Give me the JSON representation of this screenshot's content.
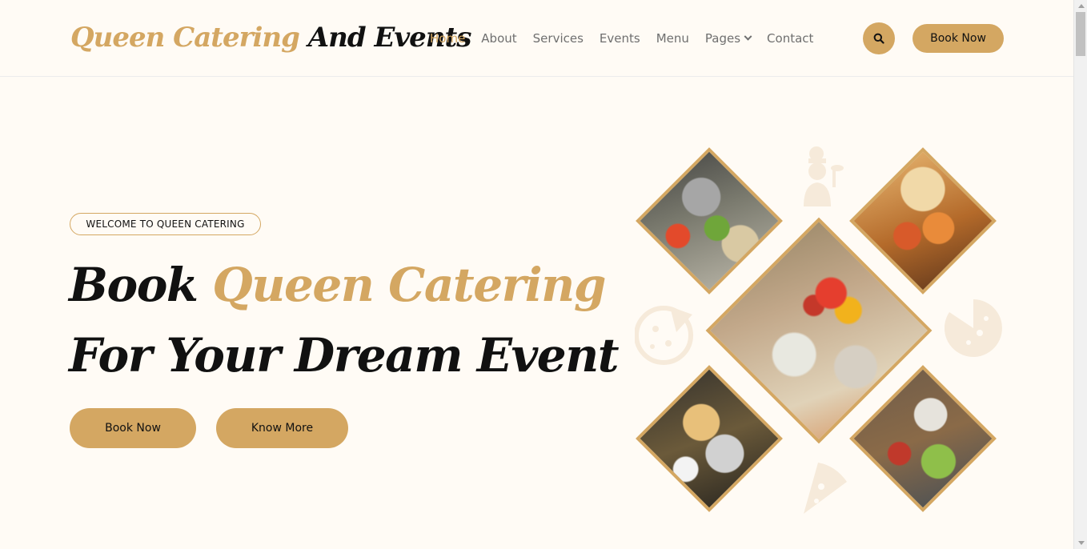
{
  "brand": {
    "accent_text": "Queen Catering",
    "dark_text": "And Events"
  },
  "nav": {
    "items": [
      {
        "label": "Home",
        "active": true
      },
      {
        "label": "About"
      },
      {
        "label": "Services"
      },
      {
        "label": "Events"
      },
      {
        "label": "Menu"
      },
      {
        "label": "Pages",
        "has_dropdown": true
      },
      {
        "label": "Contact"
      }
    ],
    "search_icon": "search-icon",
    "book_label": "Book Now"
  },
  "hero": {
    "badge": "WELCOME TO QUEEN CATERING",
    "line1_dark": "Book",
    "line1_accent": "Queen Catering",
    "line2": "For Your Dream Event",
    "book_label": "Book Now",
    "more_label": "Know More"
  },
  "colors": {
    "accent": "#d4a762",
    "dark": "#111111",
    "background": "#fffbf5",
    "muted_nav": "#6f6f6f"
  }
}
